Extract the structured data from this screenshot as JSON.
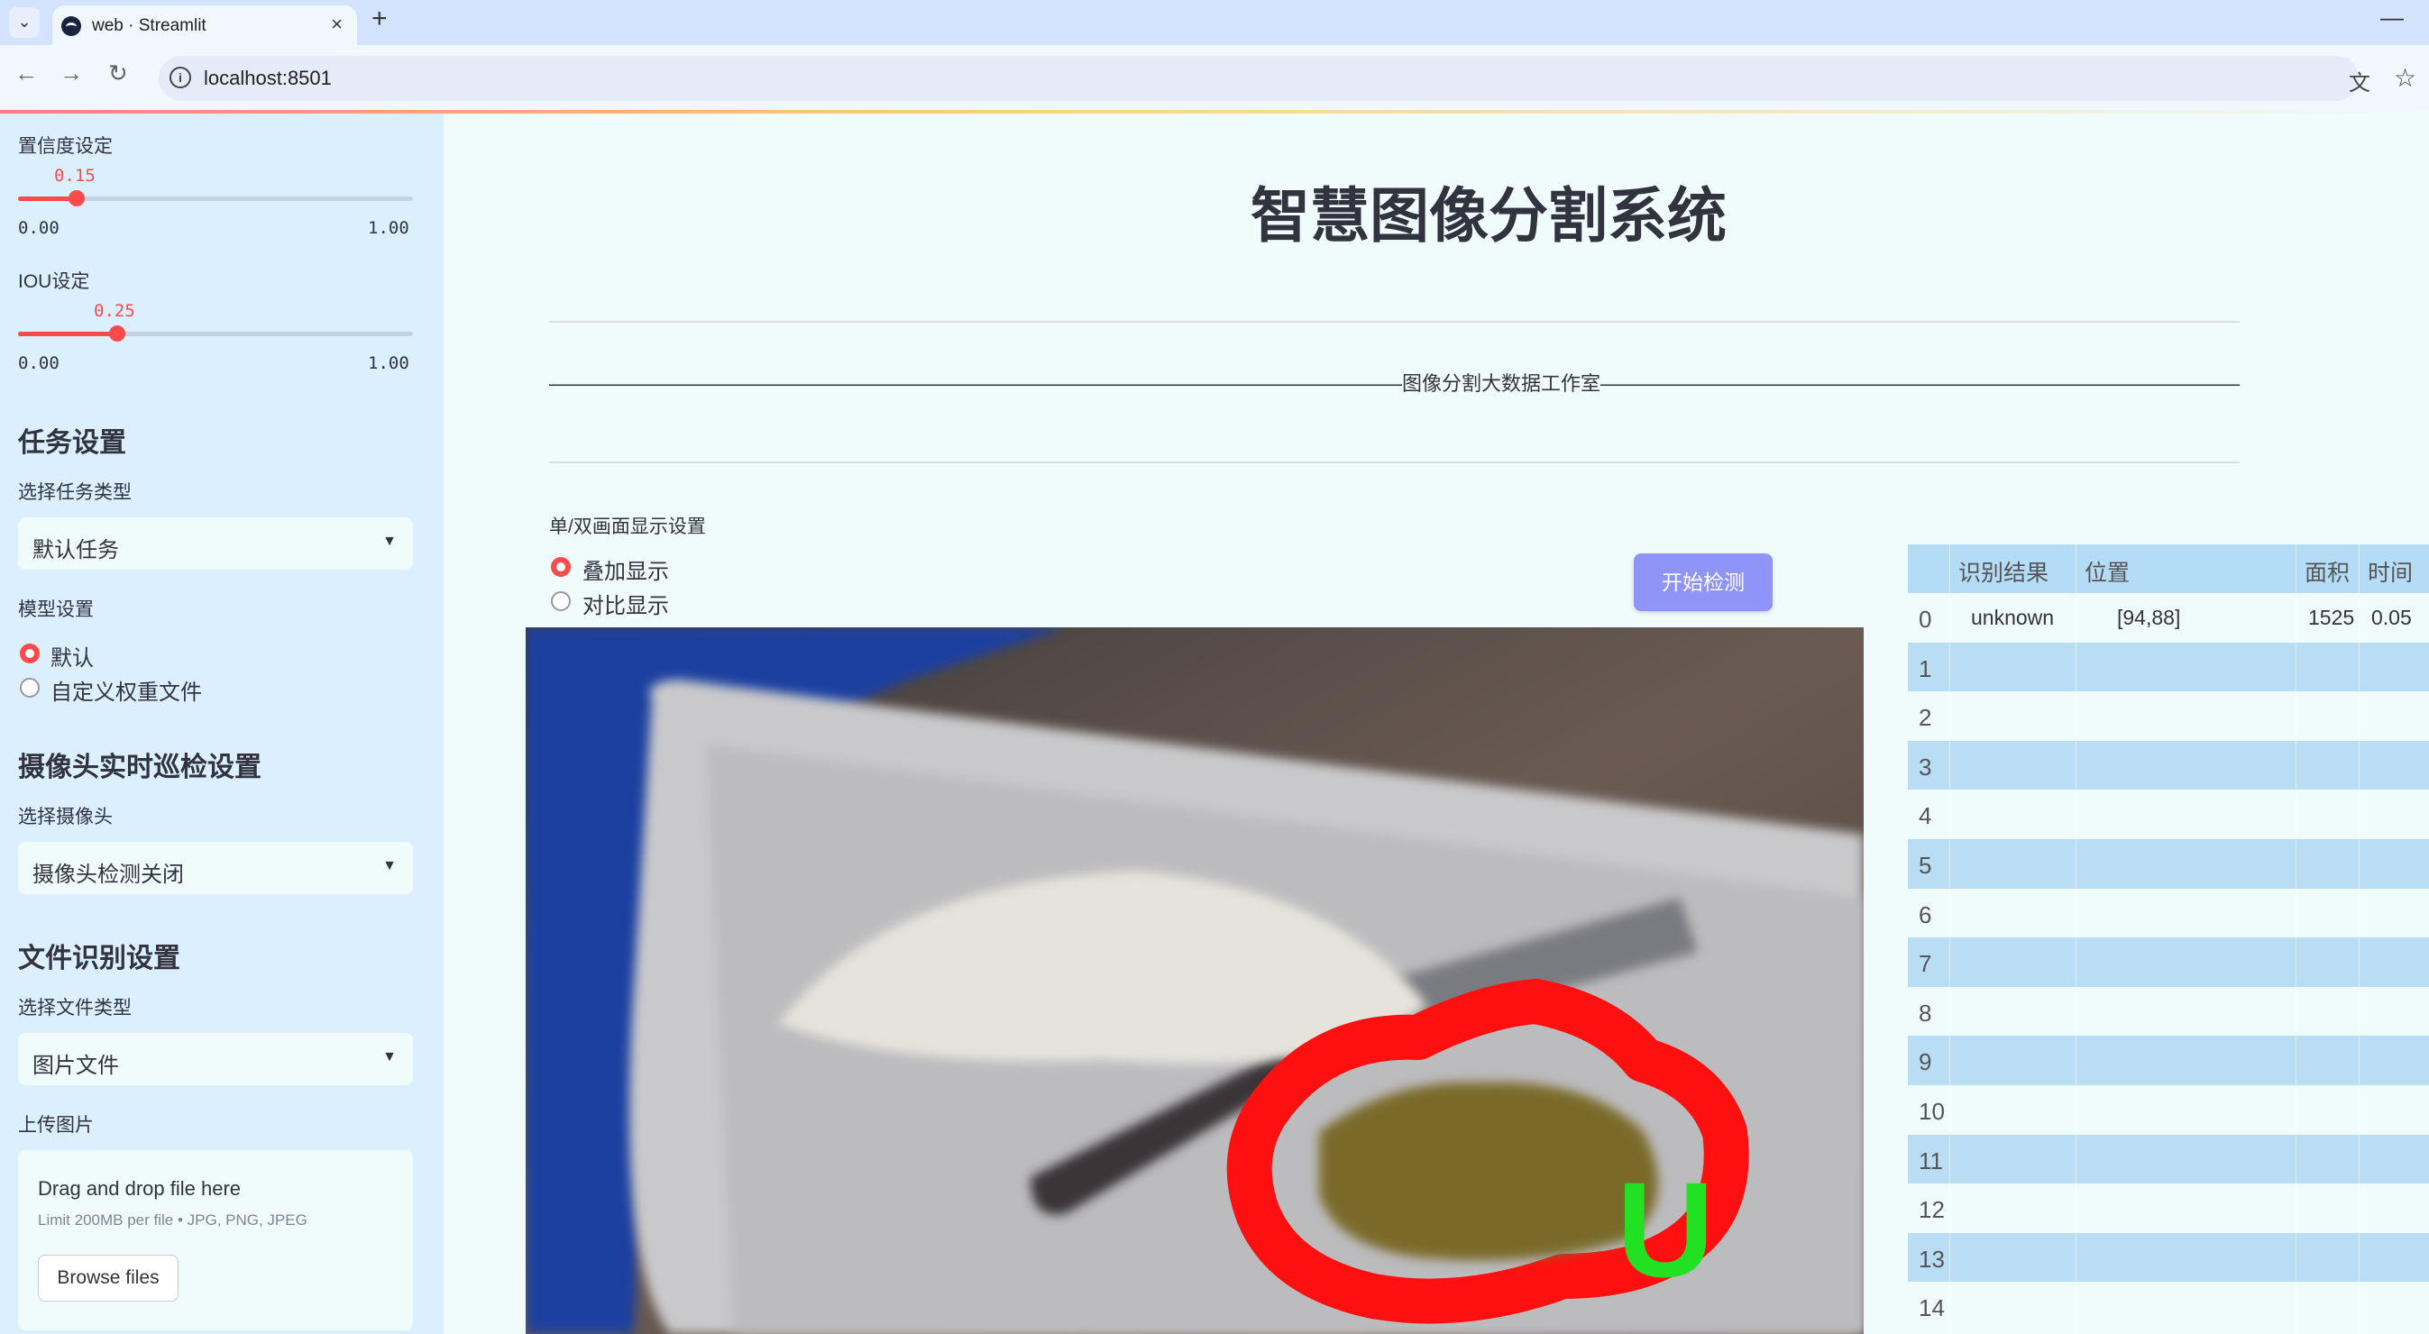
{
  "browser": {
    "tab_title": "web · Streamlit",
    "tab_close": "×",
    "new_tab": "+",
    "url": "localhost:8501",
    "minimize": "—"
  },
  "sidebar": {
    "confidence": {
      "label": "置信度设定",
      "value": "0.15",
      "level": 0.15,
      "min": "0.00",
      "max": "1.00"
    },
    "iou": {
      "label": "IOU设定",
      "value": "0.25",
      "level": 0.25,
      "min": "0.00",
      "max": "1.00"
    },
    "task_heading": "任务设置",
    "task_type_label": "选择任务类型",
    "task_type_value": "默认任务",
    "model_label": "模型设置",
    "model_options": [
      "默认",
      "自定义权重文件"
    ],
    "camera_heading": "摄像头实时巡检设置",
    "camera_label": "选择摄像头",
    "camera_value": "摄像头检测关闭",
    "file_heading": "文件识别设置",
    "file_type_label": "选择文件类型",
    "file_type_value": "图片文件",
    "upload_label": "上传图片",
    "upload_title": "Drag and drop file here",
    "upload_limit": "Limit 200MB per file • JPG, PNG, JPEG",
    "browse_button": "Browse files"
  },
  "main": {
    "title": "智慧图像分割系统",
    "subtitle_line": "———————————————————————————————————————————图像分割大数据工作室—————————————————————————————————————————————",
    "display_label": "单/双画面显示设置",
    "display_options": [
      "叠加显示",
      "对比显示"
    ],
    "start_button": "开始检测",
    "overlay_text": "U",
    "accent_color": "#ff4b4b",
    "button_color": "#8f94f8"
  },
  "table": {
    "headers": [
      "识别结果",
      "位置",
      "面积",
      "时间"
    ],
    "rows": [
      {
        "idx": "0",
        "result": "unknown",
        "position": "[94,88]",
        "area": "1525",
        "time": "0.05"
      },
      {
        "idx": "1"
      },
      {
        "idx": "2"
      },
      {
        "idx": "3"
      },
      {
        "idx": "4"
      },
      {
        "idx": "5"
      },
      {
        "idx": "6"
      },
      {
        "idx": "7"
      },
      {
        "idx": "8"
      },
      {
        "idx": "9"
      },
      {
        "idx": "10"
      },
      {
        "idx": "11"
      },
      {
        "idx": "12"
      },
      {
        "idx": "13"
      },
      {
        "idx": "14"
      }
    ]
  }
}
